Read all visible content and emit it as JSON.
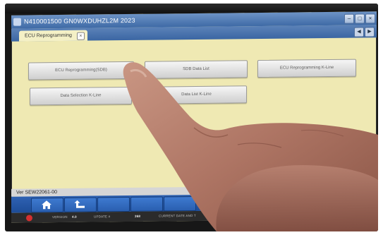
{
  "window": {
    "title": "N410001500   GN0WXDUHZL2M 2023"
  },
  "tabs": [
    {
      "label": "ECU Reprogramming",
      "active": true
    }
  ],
  "buttons": [
    {
      "label": "ECU Reprogramming(SDB)"
    },
    {
      "label": "SDB Data List"
    },
    {
      "label": "ECU Reprogramming K-Line"
    },
    {
      "label": "Data Selection K-Line"
    },
    {
      "label": "Data List K-Line"
    }
  ],
  "version_text": "Ver SEW22061-00",
  "status_bar": {
    "version_label": "VERSION",
    "version_value": "4.0",
    "update_label": "UPDATE #",
    "update_value": "368",
    "datetime_label": "CURRENT DATE AND T"
  },
  "toolbar_icons": [
    "home-icon",
    "back-icon"
  ],
  "colors": {
    "screen_bg": "#efe9b3",
    "titlebar": "#4a75b0",
    "toolbar": "#2a5fb0"
  }
}
